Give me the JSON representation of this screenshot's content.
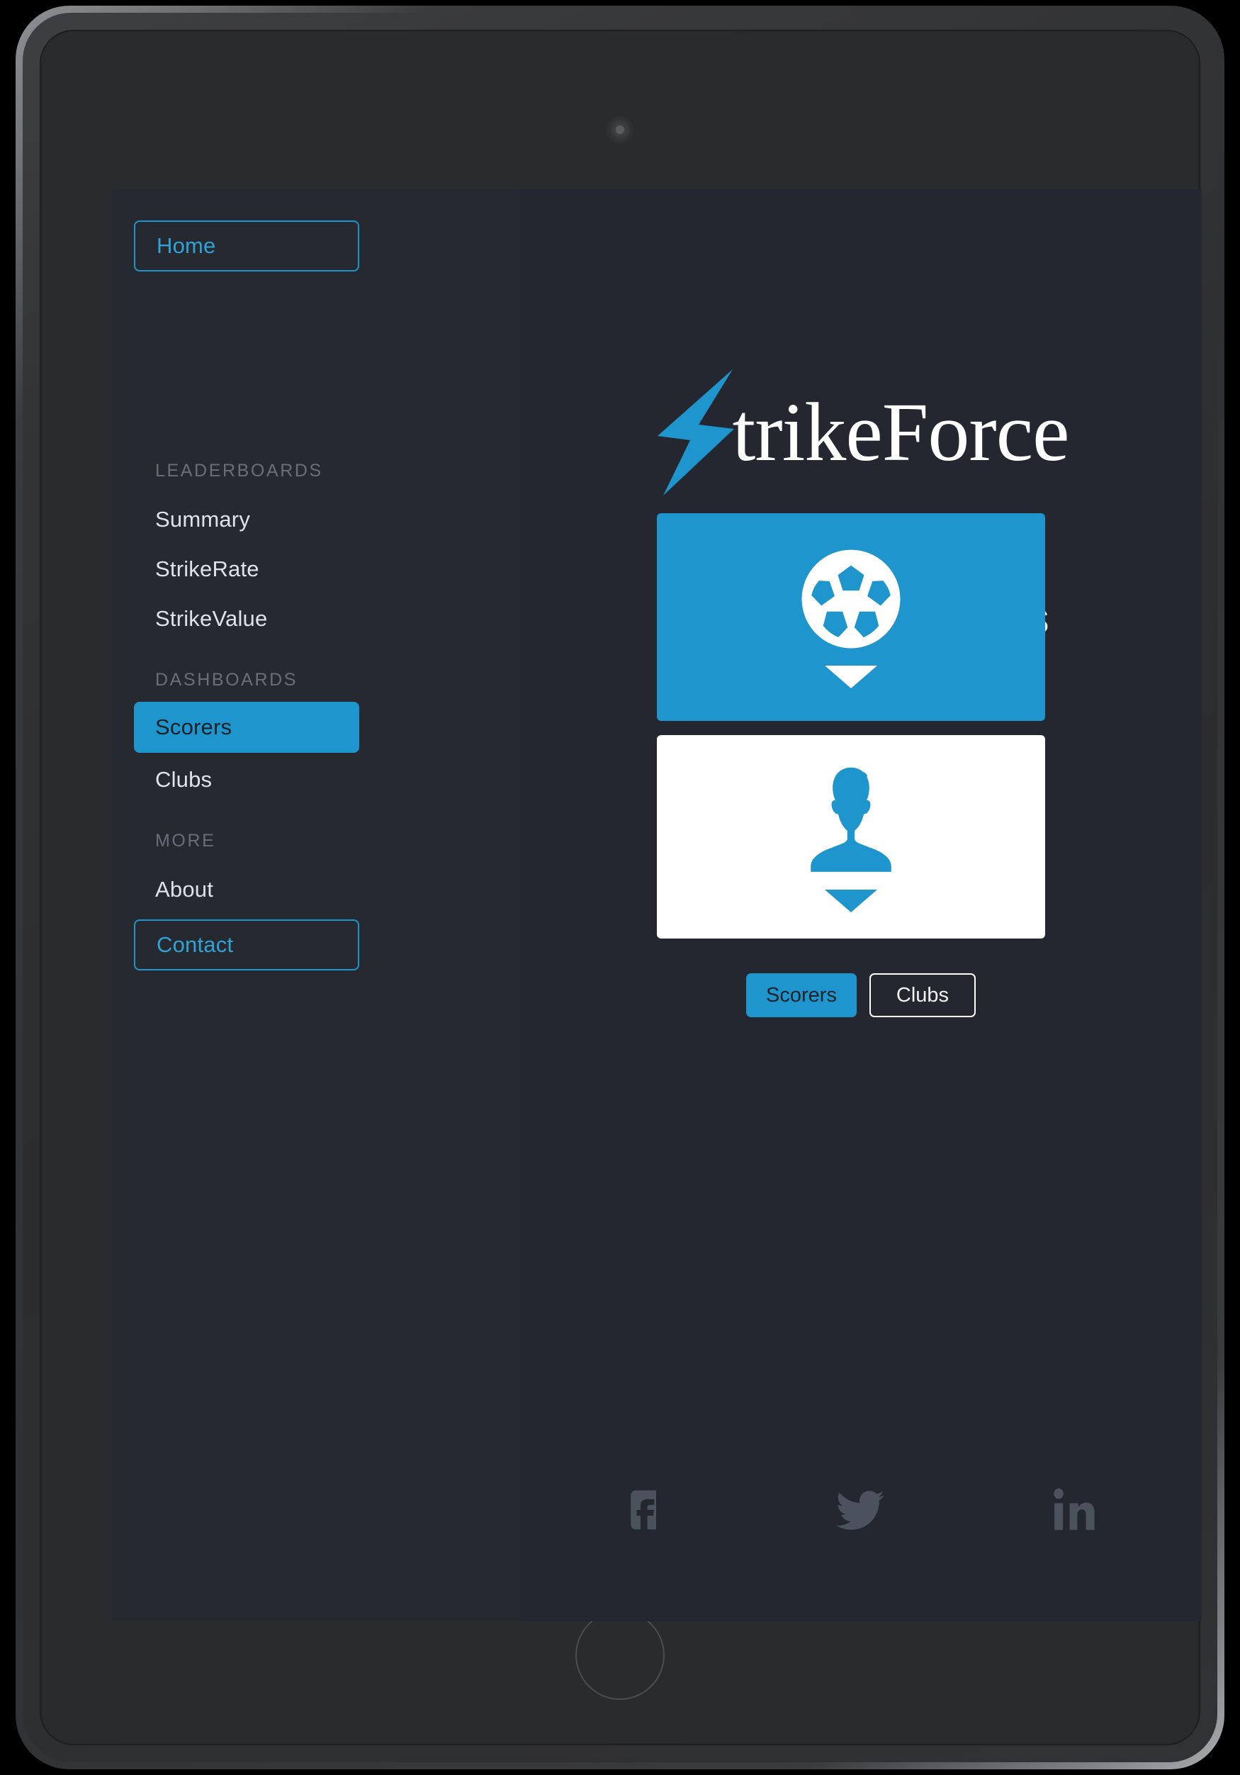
{
  "device": {
    "camera": "camera-icon",
    "home_button": "home-button"
  },
  "sidebar": {
    "home": {
      "label": "Home",
      "state": "outlined"
    },
    "sections": [
      {
        "heading": "LEADERBOARDS",
        "items": [
          {
            "label": "Summary"
          },
          {
            "label": "StrikeRate"
          },
          {
            "label": "StrikeValue"
          }
        ]
      },
      {
        "heading": "DASHBOARDS",
        "items": [
          {
            "label": "Scorers",
            "state": "active"
          },
          {
            "label": "Clubs"
          }
        ]
      },
      {
        "heading": "MORE",
        "items": [
          {
            "label": "About"
          },
          {
            "label": "Contact",
            "state": "outlined"
          }
        ]
      }
    ]
  },
  "main": {
    "brand": {
      "logo_icon": "lightning-bolt-icon",
      "text": "trikeForce",
      "full_name": "StrikeForce"
    },
    "page_title": "Scorer dashboards",
    "cards": [
      {
        "name": "scorers-card",
        "icon": "soccer-ball-icon",
        "chevron": "chevron-down-icon",
        "background": "#1E95CC",
        "icon_color": "#ffffff"
      },
      {
        "name": "clubs-card",
        "icon": "person-silhouette-icon",
        "chevron": "chevron-down-icon",
        "background": "#ffffff",
        "icon_color": "#1E95CC"
      }
    ],
    "toggles": [
      {
        "label": "Scorers",
        "state": "active"
      },
      {
        "label": "Clubs",
        "state": "inactive"
      }
    ],
    "social": [
      {
        "name": "facebook-icon"
      },
      {
        "name": "twitter-icon"
      },
      {
        "name": "linkedin-icon"
      }
    ]
  },
  "colors": {
    "accent": "#1E95CC",
    "accent_text": "#2FA3D8",
    "screen_bg": "#24272F",
    "sidebar_bg": "#262930",
    "section_heading": "#696e79",
    "nav_text": "#dfe2e6",
    "social_icon": "#4c515e"
  }
}
